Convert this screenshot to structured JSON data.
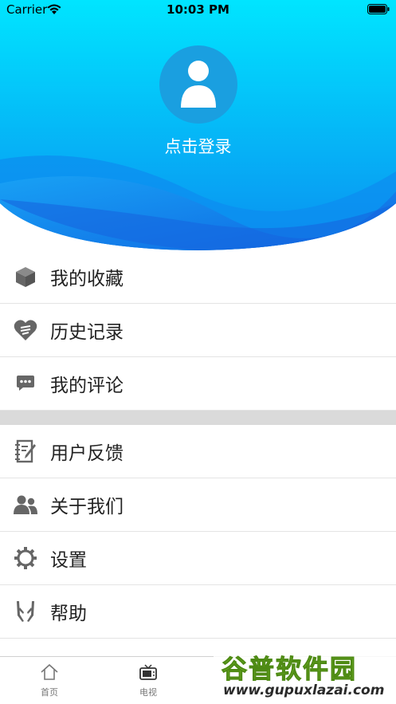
{
  "status_bar": {
    "carrier": "Carrier",
    "time": "10:03 PM"
  },
  "header": {
    "login_text": "点击登录"
  },
  "menu_group_1": [
    {
      "label": "我的收藏",
      "icon": "box-icon"
    },
    {
      "label": "历史记录",
      "icon": "heart-icon"
    },
    {
      "label": "我的评论",
      "icon": "comment-icon"
    }
  ],
  "menu_group_2": [
    {
      "label": "用户反馈",
      "icon": "notebook-icon"
    },
    {
      "label": "关于我们",
      "icon": "users-icon"
    },
    {
      "label": "设置",
      "icon": "gear-icon"
    },
    {
      "label": "帮助",
      "icon": "hands-icon"
    }
  ],
  "tab_bar": {
    "tabs": [
      {
        "label": "首页",
        "icon": "home-icon"
      },
      {
        "label": "电视",
        "icon": "tv-icon"
      }
    ]
  },
  "watermark": {
    "title": "谷普软件园",
    "url": "www.gupuxlazai.com"
  },
  "colors": {
    "header_top": "#00e0ff",
    "header_bottom": "#1470e6",
    "icon_gray": "#666666",
    "divider": "#dadada"
  }
}
